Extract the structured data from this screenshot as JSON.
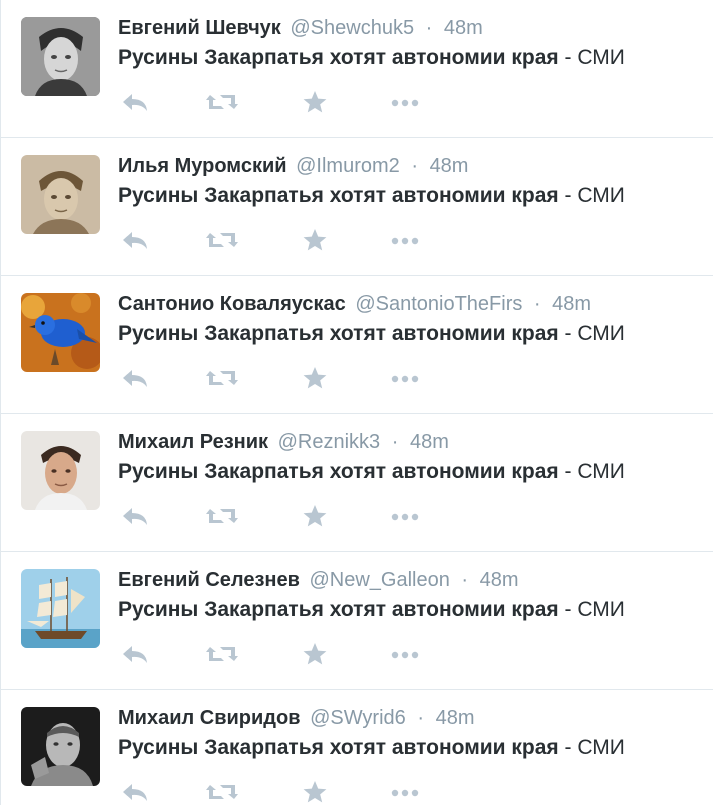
{
  "colors": {
    "name": "#292f33",
    "meta": "#8899a6",
    "icon": "#b9c6d1",
    "divider": "#e1e8ed"
  },
  "tweets": [
    {
      "fullname": "Евгений Шевчук",
      "username": "@Shewchuk5",
      "separator": "·",
      "time": "48m",
      "text_bold": "Русины Закарпатья хотят автономии края",
      "text_rest": " - СМИ",
      "avatar_icon": "portrait-bw-young-man"
    },
    {
      "fullname": "Илья Муромский",
      "username": "@Ilmurom2",
      "separator": "·",
      "time": "48m",
      "text_bold": "Русины Закарпатья хотят автономии края",
      "text_rest": " - СМИ",
      "avatar_icon": "portrait-sketch-man"
    },
    {
      "fullname": "Сантонио Коваляускас",
      "username": "@SantonioTheFirs",
      "separator": "·",
      "time": "48m",
      "text_bold": "Русины Закарпатья хотят автономии края",
      "text_rest": " - СМИ",
      "avatar_icon": "blue-bird"
    },
    {
      "fullname": "Михаил Резник",
      "username": "@Reznikk3",
      "separator": "·",
      "time": "48m",
      "text_bold": "Русины Закарпатья хотят автономии края",
      "text_rest": " - СМИ",
      "avatar_icon": "portrait-man"
    },
    {
      "fullname": "Евгений Селезнев",
      "username": "@New_Galleon",
      "separator": "·",
      "time": "48m",
      "text_bold": "Русины Закарпатья хотят автономии края",
      "text_rest": " - СМИ",
      "avatar_icon": "sailing-ship"
    },
    {
      "fullname": "Михаил Свиридов",
      "username": "@SWyrid6",
      "separator": "·",
      "time": "48m",
      "text_bold": "Русины Закарпатья хотят автономии края",
      "text_rest": " - СМИ",
      "avatar_icon": "portrait-bw-man"
    }
  ]
}
